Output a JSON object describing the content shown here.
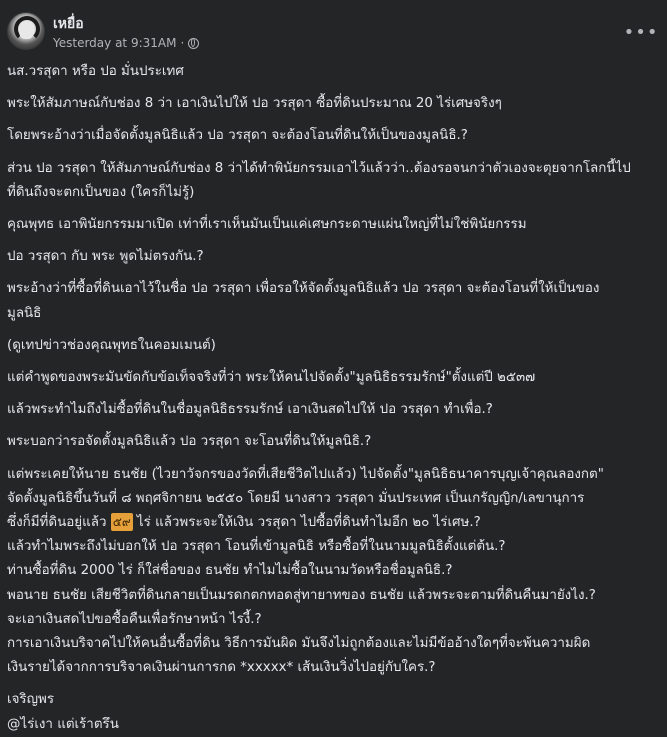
{
  "post": {
    "author": "เหยื่อ",
    "timestamp": "Yesterday at 9:31AM",
    "separator": "·",
    "privacy_icon": "globe-icon",
    "more_icon": "more-options-icon",
    "more_label": "•••",
    "lines": [
      "นส.วรสุดา หรือ ปอ มั่นประเทศ",
      "พระให้สัมภาษณ์กับช่อง 8 ว่า เอาเงินไปให้ ปอ วรสุดา ซื้อที่ดินประมาณ 20 ไร่เศษจริงๆ",
      "โดยพระอ้างว่าเมื่อจัดตั้งมูลนิธิแล้ว ปอ วรสุดา จะต้องโอนที่ดินให้เป็นของมูลนิธิ.?",
      "ส่วน ปอ วรสุดา ให้สัมภาษณ์กับช่อง 8 ว่าได้ทำพินัยกรรมเอาไว้แล้วว่า..ต้องรอจนกว่าตัวเองจะตุยจากโลกนี้ไป",
      "ที่ดินถึงจะตกเป็นของ (ใครก็ไม่รู้)",
      "คุณพุทธ เอาพินัยกรรมมาเปิด เท่าที่เราเห็นมันเป็นแค่เศษกระดาษแผ่นใหญ่ที่ไม่ใช่พินัยกรรม",
      "ปอ วรสุดา กับ พระ พูดไม่ตรงกัน.?",
      "พระอ้างว่าที่ซื้อที่ดินเอาไว้ในชื่อ ปอ วรสุดา เพื่อรอให้จัดตั้งมูลนิธิแล้ว ปอ วรสุดา จะต้องโอนที่ให้เป็นของ",
      "มูลนิธิ",
      "(ดูเทปข่าวช่องคุณพุทธในคอมเมนต์)",
      "แต่คำพูดของพระมันขัดกับข้อเท็จจริงที่ว่า พระให้คนไปจัดตั้ง\"มูลนิธิธรรมรักษ์\"ตั้งแต่ปี ๒๕๓๗",
      "แล้วพระทำไมถึงไม่ซื้อที่ดินในชื่อมูลนิธิธรรมรักษ์ เอาเงินสดไปให้ ปอ วรสุดา ทำเพื่อ.?",
      "พระบอกว่ารอจัดตั้งมูลนิธิแล้ว ปอ วรสุดา จะโอนที่ดินให้มูลนิธิ.?",
      "แต่พระเคยให้นาย ธนชัย (ไวยาวัจกรของวัดที่เสียชีวิตไปแล้ว) ไปจัดตั้ง\"มูลนิธิธนาคารบุญเจ้าคุณลองกต\"",
      "จัดตั้งมูลนิธิขึ้นวันที่ ๘ พฤศจิกายน ๒๕๕๐ โดยมี นางสาว วรสุดา มั่นประเทศ เป็นเกรัญญิก/เลขานุการ",
      "ซึ่งก็มีที่ดินอยู่แล้ว",
      "ไร่ แล้วพระจะให้เงิน วรสุดา ไปซื้อที่ดินทำไมอีก ๒๐ ไร่เศษ.?",
      "แล้วทำไมพระถึงไม่บอกให้ ปอ วรสุดา โอนที่เข้ามูลนิธิ หรือซื้อที่ในนามมูลนิธิตั้งแต่ต้น.?",
      "ท่านซื้อที่ดิน 2000 ไร่ ก็ใส่ชื่อของ ธนชัย ทำไมไม่ซื้อในนามวัดหรือชื่อมูลนิธิ.?",
      "พอนาย ธนชัย เสียชีวิตที่ดินกลายเป็นมรดกตกทอดสู่ทายาทของ ธนชัย แล้วพระจะตามที่ดินคืนมายังไง.?",
      "จะเอาเงินสดไปขอซื้อคืนเพื่อรักษาหน้า ไรงี้.?",
      "การเอาเงินบริจาคไปให้คนอื่นซื้อที่ดิน วิธีการมันผิด มันจึงไม่ถูกต้องและไม่มีข้ออ้างใดๆที่จะพ้นความผิด",
      "เงินรายได้จากการบริจาคเงินผ่านการกด *xxxxx* เส้นเงินวิ่งไปอยู่กับใคร.?",
      "เจริญพร",
      "@ไร่เงา แต่เร้าตรึน"
    ],
    "badge_value": "๕๙"
  }
}
